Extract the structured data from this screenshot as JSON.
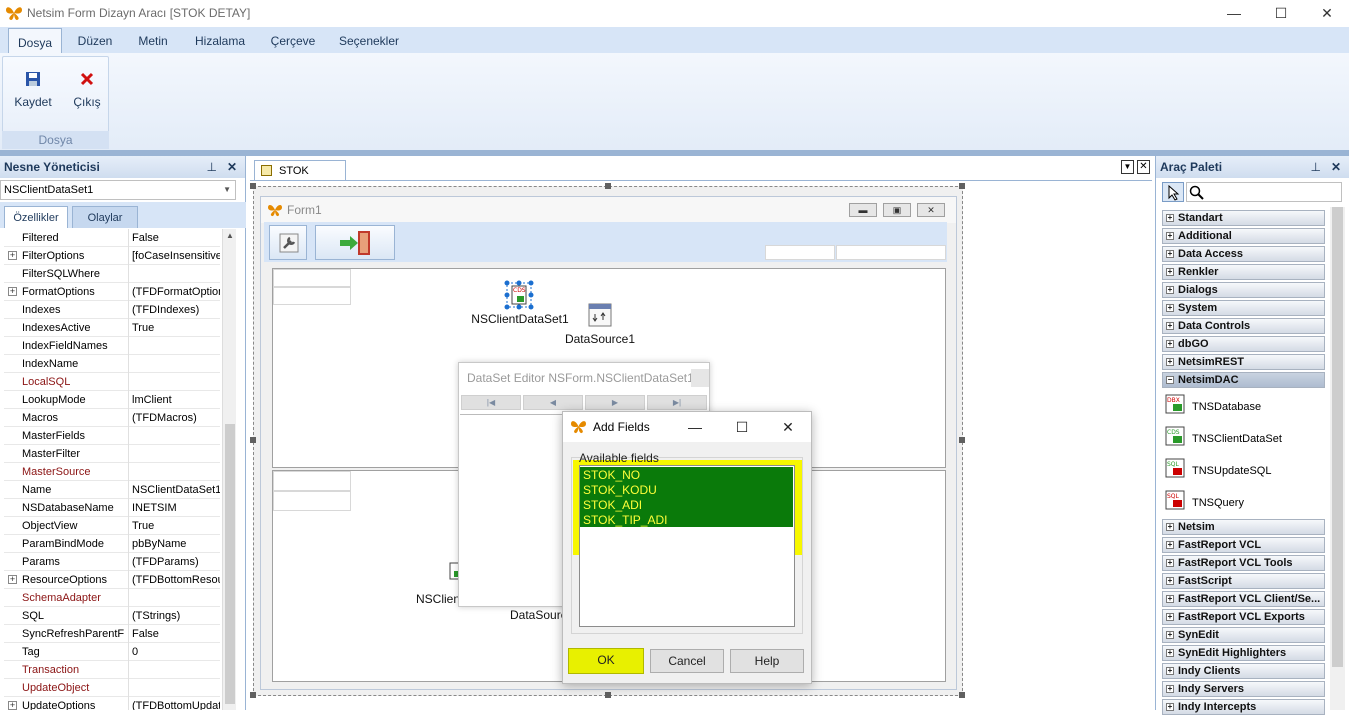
{
  "window": {
    "title": "Netsim Form Dizayn Aracı [STOK DETAY]",
    "min": "—",
    "max": "☐",
    "close": "✕"
  },
  "ribbon": {
    "tabs": [
      "Dosya",
      "Düzen",
      "Metin",
      "Hizalama",
      "Çerçeve",
      "Seçenekler"
    ],
    "buttons": {
      "save": "Kaydet",
      "exit": "Çıkış"
    },
    "group_label": "Dosya"
  },
  "object_manager": {
    "title": "Nesne Yöneticisi",
    "pin": " ↕",
    "selected": "NSClientDataSet1",
    "tabs": [
      "Özellikler",
      "Olaylar"
    ],
    "properties": [
      {
        "name": "Filtered",
        "value": "False",
        "expand": false,
        "red": false
      },
      {
        "name": "FilterOptions",
        "value": "[foCaseInsensitive",
        "expand": true,
        "red": false
      },
      {
        "name": "FilterSQLWhere",
        "value": "",
        "expand": false,
        "red": false
      },
      {
        "name": "FormatOptions",
        "value": "(TFDFormatOption",
        "expand": true,
        "red": false
      },
      {
        "name": "Indexes",
        "value": "(TFDIndexes)",
        "expand": false,
        "red": false
      },
      {
        "name": "IndexesActive",
        "value": "True",
        "expand": false,
        "red": false
      },
      {
        "name": "IndexFieldNames",
        "value": "",
        "expand": false,
        "red": false
      },
      {
        "name": "IndexName",
        "value": "",
        "expand": false,
        "red": false
      },
      {
        "name": "LocalSQL",
        "value": "",
        "expand": false,
        "red": true
      },
      {
        "name": "LookupMode",
        "value": "lmClient",
        "expand": false,
        "red": false
      },
      {
        "name": "Macros",
        "value": "(TFDMacros)",
        "expand": false,
        "red": false
      },
      {
        "name": "MasterFields",
        "value": "",
        "expand": false,
        "red": false
      },
      {
        "name": "MasterFilter",
        "value": "",
        "expand": false,
        "red": false
      },
      {
        "name": "MasterSource",
        "value": "",
        "expand": false,
        "red": true
      },
      {
        "name": "Name",
        "value": "NSClientDataSet1",
        "expand": false,
        "red": false
      },
      {
        "name": "NSDatabaseName",
        "value": "INETSIM",
        "expand": false,
        "red": false
      },
      {
        "name": "ObjectView",
        "value": "True",
        "expand": false,
        "red": false
      },
      {
        "name": "ParamBindMode",
        "value": "pbByName",
        "expand": false,
        "red": false
      },
      {
        "name": "Params",
        "value": "(TFDParams)",
        "expand": false,
        "red": false
      },
      {
        "name": "ResourceOptions",
        "value": "(TFDBottomResour",
        "expand": true,
        "red": false
      },
      {
        "name": "SchemaAdapter",
        "value": "",
        "expand": false,
        "red": true
      },
      {
        "name": "SQL",
        "value": "(TStrings)",
        "expand": false,
        "red": false
      },
      {
        "name": "SyncRefreshParentF",
        "value": "False",
        "expand": false,
        "red": false
      },
      {
        "name": "Tag",
        "value": "0",
        "expand": false,
        "red": false
      },
      {
        "name": "Transaction",
        "value": "",
        "expand": false,
        "red": true
      },
      {
        "name": "UpdateObject",
        "value": "",
        "expand": false,
        "red": true
      },
      {
        "name": "UpdateOptions",
        "value": "(TFDBottomUpdate",
        "expand": true,
        "red": false
      }
    ]
  },
  "document": {
    "tab": "STOK DETAY",
    "form_title": "Form1",
    "components": {
      "dataset1": "NSClientDataSet1",
      "datasource1": "DataSource1",
      "dataset2": "NSClient",
      "datasource2": "DataSourc"
    }
  },
  "dataset_editor": {
    "title": "DataSet Editor NSForm.NSClientDataSet1",
    "nav": [
      "|◀",
      "◀",
      "▶",
      "▶|"
    ]
  },
  "add_fields": {
    "title": "Add Fields",
    "label": "Available fields",
    "fields": [
      "STOK_NO",
      "STOK_KODU",
      "STOK_ADI",
      "STOK_TIP_ADI"
    ],
    "ok": "OK",
    "cancel": "Cancel",
    "help": "Help"
  },
  "palette": {
    "title": "Araç Paleti",
    "categories_top": [
      "Standart",
      "Additional",
      "Data Access",
      "Renkler",
      "Dialogs",
      "System",
      "Data Controls",
      "dbGO",
      "NetsimREST",
      "NetsimDAC"
    ],
    "items": [
      "TNSDatabase",
      "TNSClientDataSet",
      "TNSUpdateSQL",
      "TNSQuery"
    ],
    "categories_bottom": [
      "Netsim",
      "FastReport VCL",
      "FastReport VCL Tools",
      "FastScript",
      "FastReport VCL Client/Se...",
      "FastReport VCL Exports",
      "SynEdit",
      "SynEdit Highlighters",
      "Indy Clients",
      "Indy Servers",
      "Indy Intercepts"
    ]
  },
  "colors": {
    "ribbon_bg": "#d7e5f7",
    "selection_green": "#0a7a0a",
    "highlight_yellow": "#f7f700",
    "field_text": "#ffff3a"
  }
}
